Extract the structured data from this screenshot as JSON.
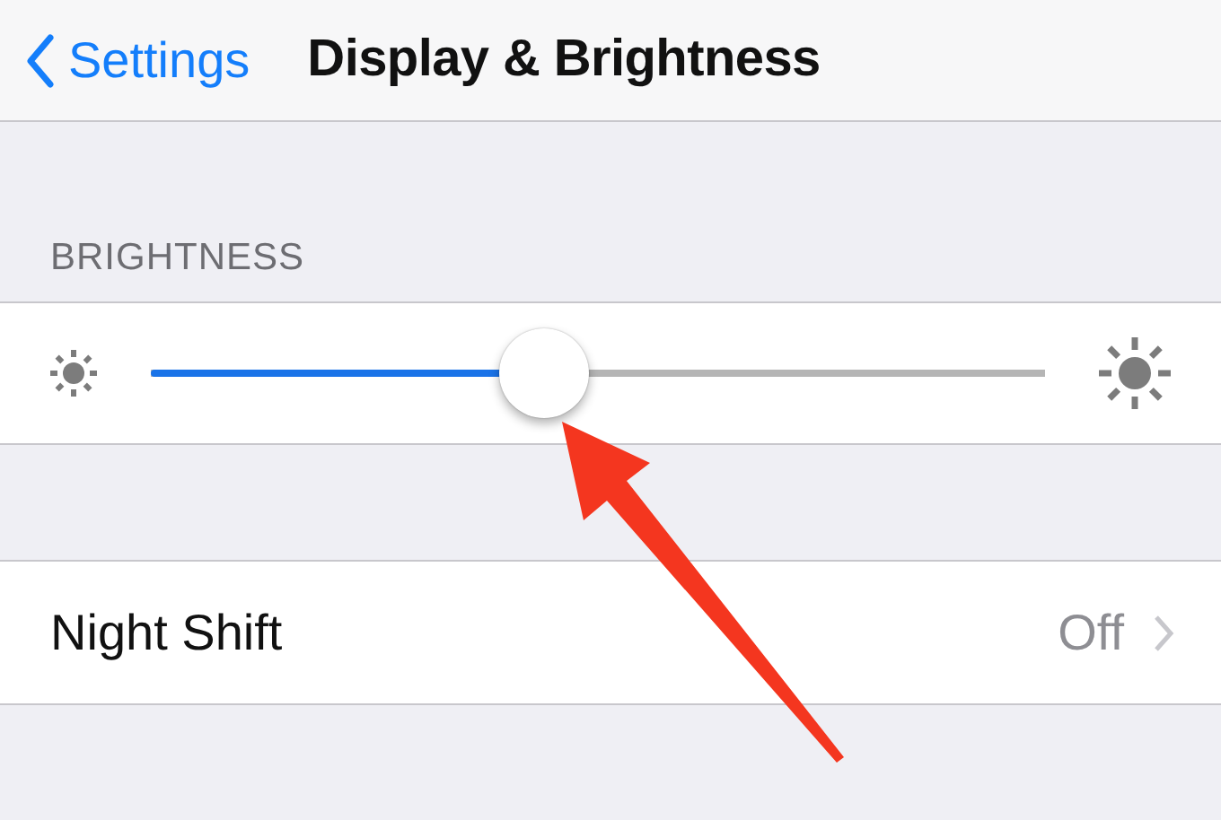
{
  "nav_bar": {
    "back_label": "Settings",
    "title": "Display & Brightness"
  },
  "brightness_section": {
    "header": "BRIGHTNESS",
    "slider": {
      "level": 0.44
    }
  },
  "rows": [
    {
      "label": "Night Shift",
      "value": "Off"
    }
  ]
}
